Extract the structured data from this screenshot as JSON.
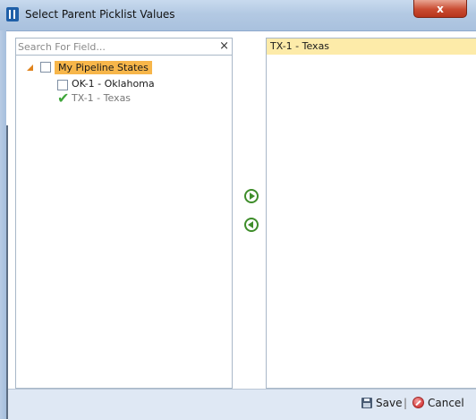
{
  "window": {
    "title": "Select Parent Picklist Values",
    "close_label": "x"
  },
  "left_panel": {
    "search": {
      "placeholder": "Search For Field...",
      "clear_label": "×"
    },
    "tree": {
      "root": {
        "label": "My Pipeline States",
        "checked": false,
        "expanded": true,
        "selected": true
      },
      "children": [
        {
          "label": "OK-1 - Oklahoma",
          "state": "unchecked"
        },
        {
          "label": "TX-1 - Texas",
          "state": "moved",
          "marker": "✔"
        }
      ]
    }
  },
  "transfer": {
    "add_icon": "arrow-right-circle-icon",
    "remove_icon": "arrow-left-circle-icon"
  },
  "right_panel": {
    "items": [
      {
        "label": "TX-1 - Texas",
        "highlighted": true
      }
    ]
  },
  "footer": {
    "save_label": "Save",
    "separator": "|",
    "cancel_label": "Cancel"
  },
  "colors": {
    "titlebar": "#b3c9e3",
    "close_button": "#c94b31",
    "tree_highlight": "#f7b64a",
    "list_highlight": "#fdeba9",
    "arrow_green": "#3e8d2a",
    "check_green": "#3fa63a",
    "footer_bg": "#dfe8f4"
  }
}
